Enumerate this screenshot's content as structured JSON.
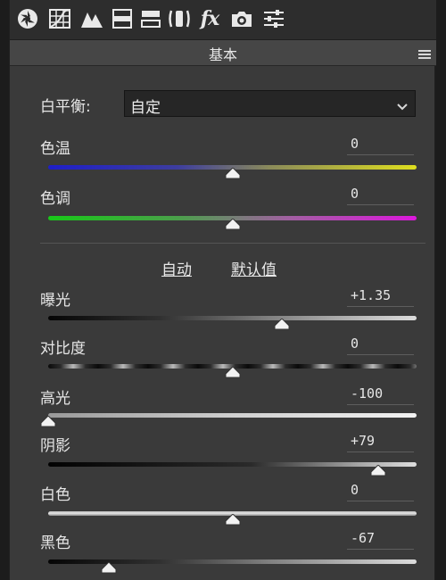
{
  "toolbar": {
    "icons": [
      "aperture-icon",
      "tone-curve-grid-icon",
      "detail-mountains-icon",
      "hsl-grid-icon",
      "split-toning-icon",
      "lens-correction-icon",
      "fx-icon",
      "camera-icon",
      "presets-sliders-icon"
    ],
    "fx_label": "fx"
  },
  "section": {
    "title": "基本"
  },
  "white_balance": {
    "label": "白平衡:",
    "selected": "自定"
  },
  "auto_label": "自动",
  "default_label": "默认值",
  "sliders": [
    {
      "id": "temperature",
      "label": "色温",
      "value": "0",
      "position": 0.5
    },
    {
      "id": "tint",
      "label": "色调",
      "value": "0",
      "position": 0.5
    },
    {
      "id": "exposure",
      "label": "曝光",
      "value": "+1.35",
      "position": 0.635
    },
    {
      "id": "contrast",
      "label": "对比度",
      "value": "0",
      "position": 0.5
    },
    {
      "id": "highlights",
      "label": "高光",
      "value": "-100",
      "position": 0.0
    },
    {
      "id": "shadows",
      "label": "阴影",
      "value": "+79",
      "position": 0.895
    },
    {
      "id": "whites",
      "label": "白色",
      "value": "0",
      "position": 0.5
    },
    {
      "id": "blacks",
      "label": "黑色",
      "value": "-67",
      "position": 0.165
    }
  ],
  "colors": {
    "panel": "#3a3a3a",
    "toolbar": "#2d2d2d",
    "header": "#464646",
    "field": "#262626"
  }
}
